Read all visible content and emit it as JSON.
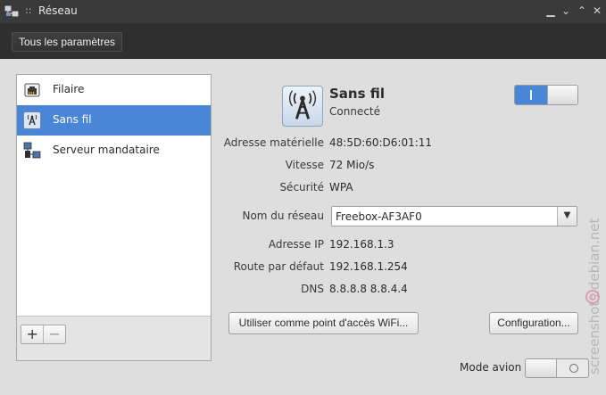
{
  "window": {
    "title": "Réseau",
    "title_dots": "::"
  },
  "toolbar": {
    "all_settings_label": "Tous les paramètres"
  },
  "sidebar": {
    "items": [
      {
        "label": "Filaire",
        "icon": "wired-network-icon",
        "selected": false
      },
      {
        "label": "Sans fil",
        "icon": "wireless-network-icon",
        "selected": true
      },
      {
        "label": "Serveur mandataire",
        "icon": "proxy-server-icon",
        "selected": false
      }
    ],
    "add_label": "+",
    "remove_label": "−"
  },
  "detail": {
    "title": "Sans fil",
    "status": "Connecté",
    "wireless_switch": {
      "state": "on",
      "on_label": "I"
    },
    "rows": [
      {
        "label": "Adresse matérielle",
        "value": "48:5D:60:D6:01:11"
      },
      {
        "label": "Vitesse",
        "value": "72 Mio/s"
      },
      {
        "label": "Sécurité",
        "value": "WPA"
      }
    ],
    "network_name": {
      "label": "Nom du réseau",
      "selected": "Freebox-AF3AF0"
    },
    "ip_rows": [
      {
        "label": "Adresse IP",
        "value": "192.168.1.3"
      },
      {
        "label": "Route par défaut",
        "value": "192.168.1.254"
      },
      {
        "label": "DNS",
        "value": "8.8.8.8 8.8.4.4"
      }
    ],
    "hotspot_button": "Utiliser comme point d'accès WiFi...",
    "config_button": "Configuration..."
  },
  "airplane_mode": {
    "label": "Mode avion",
    "state": "off"
  },
  "watermark": {
    "text": "screenshots.debian.net"
  },
  "colors": {
    "accent": "#4a86d6",
    "titlebar": "#3a3a3a",
    "toolbar": "#2f2f2f",
    "background": "#dedede"
  }
}
